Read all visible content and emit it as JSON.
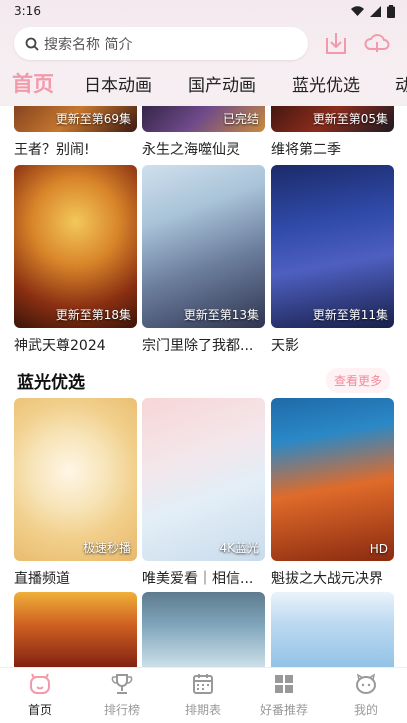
{
  "status": {
    "time": "3:16"
  },
  "search": {
    "placeholder": "搜索名称 简介"
  },
  "tabs": [
    {
      "label": "首页"
    },
    {
      "label": "日本动画"
    },
    {
      "label": "国产动画"
    },
    {
      "label": "蓝光优选"
    },
    {
      "label": "动"
    }
  ],
  "top_row": [
    {
      "title": "王者？别闹!",
      "badge": "更新至第69集"
    },
    {
      "title": "永生之海噬仙灵",
      "badge": "已完结"
    },
    {
      "title": "维将第二季",
      "badge": "更新至第05集"
    }
  ],
  "row2": [
    {
      "title": "神武天尊2024",
      "badge": "更新至第18集"
    },
    {
      "title": "宗门里除了我都...",
      "badge": "更新至第13集"
    },
    {
      "title": "天影",
      "badge": "更新至第11集"
    }
  ],
  "bluray": {
    "title": "蓝光优选",
    "more": "查看更多",
    "items": [
      {
        "title": "直播频道",
        "badge": "极速秒播"
      },
      {
        "title": "唯美爱看｜相信...",
        "badge": "4K蓝光"
      },
      {
        "title": "魁拔之大战元决界",
        "badge": "HD"
      }
    ]
  },
  "nav": [
    {
      "label": "首页",
      "icon": "home-icon"
    },
    {
      "label": "排行榜",
      "icon": "trophy-icon"
    },
    {
      "label": "排期表",
      "icon": "calendar-icon"
    },
    {
      "label": "好番推荐",
      "icon": "grid-icon"
    },
    {
      "label": "我的",
      "icon": "profile-icon"
    }
  ],
  "colors": {
    "accent": "#f29aab",
    "header_bg": "#f5eef1"
  }
}
